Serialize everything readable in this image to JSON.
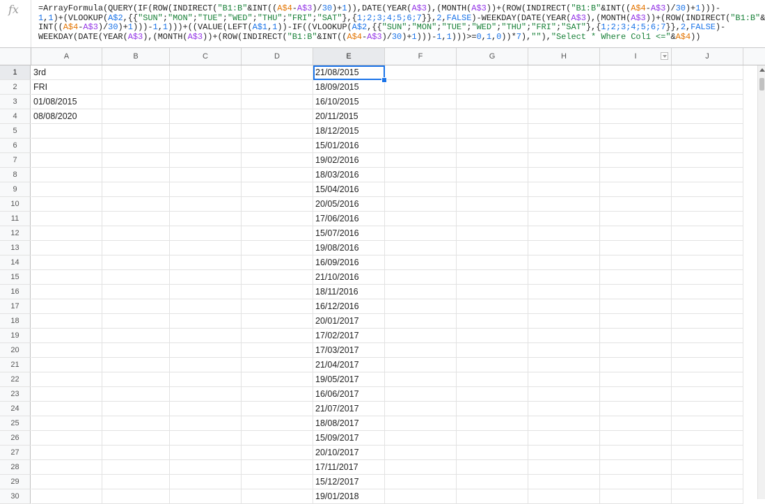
{
  "formula_bar": {
    "icon": "fx-icon",
    "icon_text": "fx",
    "lines": [
      [
        {
          "t": "=ArrayFormula(QUERY(IF(ROW(INDIRECT(",
          "c": ""
        },
        {
          "t": "\"B1:B\"",
          "c": "str"
        },
        {
          "t": "&INT((",
          "c": ""
        },
        {
          "t": "A$4",
          "c": "ref"
        },
        {
          "t": "-",
          "c": ""
        },
        {
          "t": "A$3",
          "c": "ref2"
        },
        {
          "t": ")/",
          "c": ""
        },
        {
          "t": "30",
          "c": "num"
        },
        {
          "t": ")+",
          "c": ""
        },
        {
          "t": "1",
          "c": "num"
        },
        {
          "t": ")),DATE(YEAR(",
          "c": ""
        },
        {
          "t": "A$3",
          "c": "ref2"
        },
        {
          "t": "),(MONTH(",
          "c": ""
        },
        {
          "t": "A$3",
          "c": "ref2"
        },
        {
          "t": "))+(ROW(INDIRECT(",
          "c": ""
        },
        {
          "t": "\"B1:B\"",
          "c": "str"
        },
        {
          "t": "&INT((",
          "c": ""
        },
        {
          "t": "A$4",
          "c": "ref"
        },
        {
          "t": "-",
          "c": ""
        },
        {
          "t": "A$3",
          "c": "ref2"
        },
        {
          "t": ")/",
          "c": ""
        },
        {
          "t": "30",
          "c": "num"
        },
        {
          "t": ")+",
          "c": ""
        },
        {
          "t": "1",
          "c": "num"
        },
        {
          "t": ")))-",
          "c": ""
        }
      ],
      [
        {
          "t": "1",
          "c": "num"
        },
        {
          "t": ",",
          "c": ""
        },
        {
          "t": "1",
          "c": "num"
        },
        {
          "t": ")+(VLOOKUP(",
          "c": ""
        },
        {
          "t": "A$2",
          "c": "ref3"
        },
        {
          "t": ",{{",
          "c": ""
        },
        {
          "t": "\"SUN\"",
          "c": "str"
        },
        {
          "t": ";",
          "c": ""
        },
        {
          "t": "\"MON\"",
          "c": "str"
        },
        {
          "t": ";",
          "c": ""
        },
        {
          "t": "\"TUE\"",
          "c": "str"
        },
        {
          "t": ";",
          "c": ""
        },
        {
          "t": "\"WED\"",
          "c": "str"
        },
        {
          "t": ";",
          "c": ""
        },
        {
          "t": "\"THU\"",
          "c": "str"
        },
        {
          "t": ";",
          "c": ""
        },
        {
          "t": "\"FRI\"",
          "c": "str"
        },
        {
          "t": ";",
          "c": ""
        },
        {
          "t": "\"SAT\"",
          "c": "str"
        },
        {
          "t": "},{",
          "c": ""
        },
        {
          "t": "1;2;3;4;5;6;7",
          "c": "num"
        },
        {
          "t": "}},",
          "c": ""
        },
        {
          "t": "2",
          "c": "num"
        },
        {
          "t": ",",
          "c": ""
        },
        {
          "t": "FALSE",
          "c": "bool"
        },
        {
          "t": ")-WEEKDAY(DATE(YEAR(",
          "c": ""
        },
        {
          "t": "A$3",
          "c": "ref2"
        },
        {
          "t": "),(MONTH(",
          "c": ""
        },
        {
          "t": "A$3",
          "c": "ref2"
        },
        {
          "t": "))+(ROW(INDIRECT(",
          "c": ""
        },
        {
          "t": "\"B1:B\"",
          "c": "str"
        },
        {
          "t": "&",
          "c": ""
        }
      ],
      [
        {
          "t": "INT((",
          "c": ""
        },
        {
          "t": "A$4",
          "c": "ref"
        },
        {
          "t": "-",
          "c": ""
        },
        {
          "t": "A$3",
          "c": "ref2"
        },
        {
          "t": ")/",
          "c": ""
        },
        {
          "t": "30",
          "c": "num"
        },
        {
          "t": ")+",
          "c": ""
        },
        {
          "t": "1",
          "c": "num"
        },
        {
          "t": ")))-",
          "c": ""
        },
        {
          "t": "1",
          "c": "num"
        },
        {
          "t": ",",
          "c": ""
        },
        {
          "t": "1",
          "c": "num"
        },
        {
          "t": ")))+((VALUE(LEFT(",
          "c": ""
        },
        {
          "t": "A$1",
          "c": "ref3"
        },
        {
          "t": ",",
          "c": ""
        },
        {
          "t": "1",
          "c": "num"
        },
        {
          "t": "))-IF((VLOOKUP(",
          "c": ""
        },
        {
          "t": "A$2",
          "c": "ref3"
        },
        {
          "t": ",{{",
          "c": ""
        },
        {
          "t": "\"SUN\"",
          "c": "str"
        },
        {
          "t": ";",
          "c": ""
        },
        {
          "t": "\"MON\"",
          "c": "str"
        },
        {
          "t": ";",
          "c": ""
        },
        {
          "t": "\"TUE\"",
          "c": "str"
        },
        {
          "t": ";",
          "c": ""
        },
        {
          "t": "\"WED\"",
          "c": "str"
        },
        {
          "t": ";",
          "c": ""
        },
        {
          "t": "\"THU\"",
          "c": "str"
        },
        {
          "t": ";",
          "c": ""
        },
        {
          "t": "\"FRI\"",
          "c": "str"
        },
        {
          "t": ";",
          "c": ""
        },
        {
          "t": "\"SAT\"",
          "c": "str"
        },
        {
          "t": "},{",
          "c": ""
        },
        {
          "t": "1;2;3;4;5;6;7",
          "c": "num"
        },
        {
          "t": "}},",
          "c": ""
        },
        {
          "t": "2",
          "c": "num"
        },
        {
          "t": ",",
          "c": ""
        },
        {
          "t": "FALSE",
          "c": "bool"
        },
        {
          "t": ")-",
          "c": ""
        }
      ],
      [
        {
          "t": "WEEKDAY(DATE(YEAR(",
          "c": ""
        },
        {
          "t": "A$3",
          "c": "ref2"
        },
        {
          "t": "),(MONTH(",
          "c": ""
        },
        {
          "t": "A$3",
          "c": "ref2"
        },
        {
          "t": "))+(ROW(INDIRECT(",
          "c": ""
        },
        {
          "t": "\"B1:B\"",
          "c": "str"
        },
        {
          "t": "&INT((",
          "c": ""
        },
        {
          "t": "A$4",
          "c": "ref"
        },
        {
          "t": "-",
          "c": ""
        },
        {
          "t": "A$3",
          "c": "ref2"
        },
        {
          "t": ")/",
          "c": ""
        },
        {
          "t": "30",
          "c": "num"
        },
        {
          "t": ")+",
          "c": ""
        },
        {
          "t": "1",
          "c": "num"
        },
        {
          "t": ")))-",
          "c": ""
        },
        {
          "t": "1",
          "c": "num"
        },
        {
          "t": ",",
          "c": ""
        },
        {
          "t": "1",
          "c": "num"
        },
        {
          "t": ")))>=",
          "c": ""
        },
        {
          "t": "0",
          "c": "num"
        },
        {
          "t": ",",
          "c": ""
        },
        {
          "t": "1",
          "c": "num"
        },
        {
          "t": ",",
          "c": ""
        },
        {
          "t": "0",
          "c": "num"
        },
        {
          "t": "))*",
          "c": ""
        },
        {
          "t": "7",
          "c": "num"
        },
        {
          "t": "),",
          "c": ""
        },
        {
          "t": "\"\"",
          "c": "str"
        },
        {
          "t": "),",
          "c": ""
        },
        {
          "t": "\"Select * Where Col1 <=\"",
          "c": "str"
        },
        {
          "t": "&",
          "c": ""
        },
        {
          "t": "A$4",
          "c": "ref"
        },
        {
          "t": "))",
          "c": ""
        }
      ]
    ]
  },
  "grid": {
    "columns": [
      "A",
      "B",
      "C",
      "D",
      "E",
      "F",
      "G",
      "H",
      "I",
      "J"
    ],
    "selected_column": "E",
    "active_cell": "E1",
    "rows": [
      {
        "n": "1",
        "A": "3rd",
        "E": "21/08/2015"
      },
      {
        "n": "2",
        "A": "FRI",
        "E": "18/09/2015"
      },
      {
        "n": "3",
        "A": "01/08/2015",
        "E": "16/10/2015"
      },
      {
        "n": "4",
        "A": "08/08/2020",
        "E": "20/11/2015"
      },
      {
        "n": "5",
        "A": "",
        "E": "18/12/2015"
      },
      {
        "n": "6",
        "A": "",
        "E": "15/01/2016"
      },
      {
        "n": "7",
        "A": "",
        "E": "19/02/2016"
      },
      {
        "n": "8",
        "A": "",
        "E": "18/03/2016"
      },
      {
        "n": "9",
        "A": "",
        "E": "15/04/2016"
      },
      {
        "n": "10",
        "A": "",
        "E": "20/05/2016"
      },
      {
        "n": "11",
        "A": "",
        "E": "17/06/2016"
      },
      {
        "n": "12",
        "A": "",
        "E": "15/07/2016"
      },
      {
        "n": "13",
        "A": "",
        "E": "19/08/2016"
      },
      {
        "n": "14",
        "A": "",
        "E": "16/09/2016"
      },
      {
        "n": "15",
        "A": "",
        "E": "21/10/2016"
      },
      {
        "n": "16",
        "A": "",
        "E": "18/11/2016"
      },
      {
        "n": "17",
        "A": "",
        "E": "16/12/2016"
      },
      {
        "n": "18",
        "A": "",
        "E": "20/01/2017"
      },
      {
        "n": "19",
        "A": "",
        "E": "17/02/2017"
      },
      {
        "n": "20",
        "A": "",
        "E": "17/03/2017"
      },
      {
        "n": "21",
        "A": "",
        "E": "21/04/2017"
      },
      {
        "n": "22",
        "A": "",
        "E": "19/05/2017"
      },
      {
        "n": "23",
        "A": "",
        "E": "16/06/2017"
      },
      {
        "n": "24",
        "A": "",
        "E": "21/07/2017"
      },
      {
        "n": "25",
        "A": "",
        "E": "18/08/2017"
      },
      {
        "n": "26",
        "A": "",
        "E": "15/09/2017"
      },
      {
        "n": "27",
        "A": "",
        "E": "20/10/2017"
      },
      {
        "n": "28",
        "A": "",
        "E": "17/11/2017"
      },
      {
        "n": "29",
        "A": "",
        "E": "15/12/2017"
      },
      {
        "n": "30",
        "A": "",
        "E": "19/01/2018"
      }
    ]
  },
  "colors": {
    "selection": "#1a73e8",
    "header_bg": "#f8f9fa",
    "string": "#188038",
    "range_ref": "#e37400"
  }
}
